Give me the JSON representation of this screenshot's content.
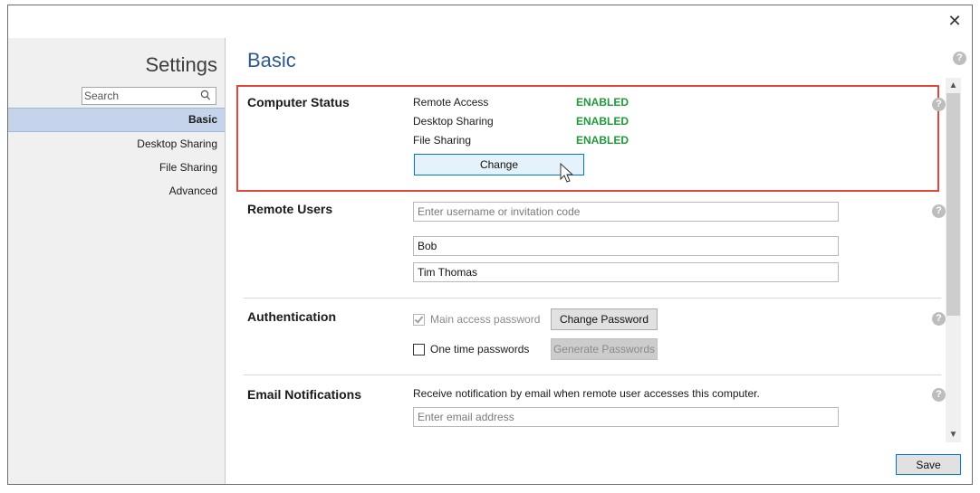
{
  "window": {
    "title": "",
    "close_glyph": "✕"
  },
  "sidebar": {
    "title": "Settings",
    "search": {
      "placeholder": "Search",
      "value": ""
    },
    "items": [
      {
        "label": "Basic",
        "active": true
      },
      {
        "label": "Desktop Sharing",
        "active": false
      },
      {
        "label": "File Sharing",
        "active": false
      },
      {
        "label": "Advanced",
        "active": false
      }
    ]
  },
  "main": {
    "title": "Basic",
    "computer_status": {
      "label": "Computer Status",
      "rows": [
        {
          "name": "Remote Access",
          "value": "ENABLED"
        },
        {
          "name": "Desktop Sharing",
          "value": "ENABLED"
        },
        {
          "name": "File Sharing",
          "value": "ENABLED"
        }
      ],
      "change_button": "Change"
    },
    "remote_users": {
      "label": "Remote Users",
      "input_placeholder": "Enter username or invitation code",
      "users": [
        "Bob",
        "Tim Thomas"
      ]
    },
    "authentication": {
      "label": "Authentication",
      "main_password": {
        "label": "Main access password",
        "checked": true,
        "disabled": true
      },
      "change_password_button": "Change Password",
      "one_time": {
        "label": "One time passwords",
        "checked": false
      },
      "generate_button": "Generate Passwords"
    },
    "email_notifications": {
      "label": "Email Notifications",
      "description": "Receive notification by email when remote user accesses this computer.",
      "placeholder": "Enter email address"
    },
    "save_button": "Save"
  },
  "colors": {
    "accent": "#2e5a8a",
    "enabled": "#1f9a3a",
    "highlight_border": "#e0473d",
    "nav_active": "#c5d4ea"
  },
  "icons": {
    "help": "help-icon",
    "search": "search-icon",
    "close": "close-icon"
  }
}
